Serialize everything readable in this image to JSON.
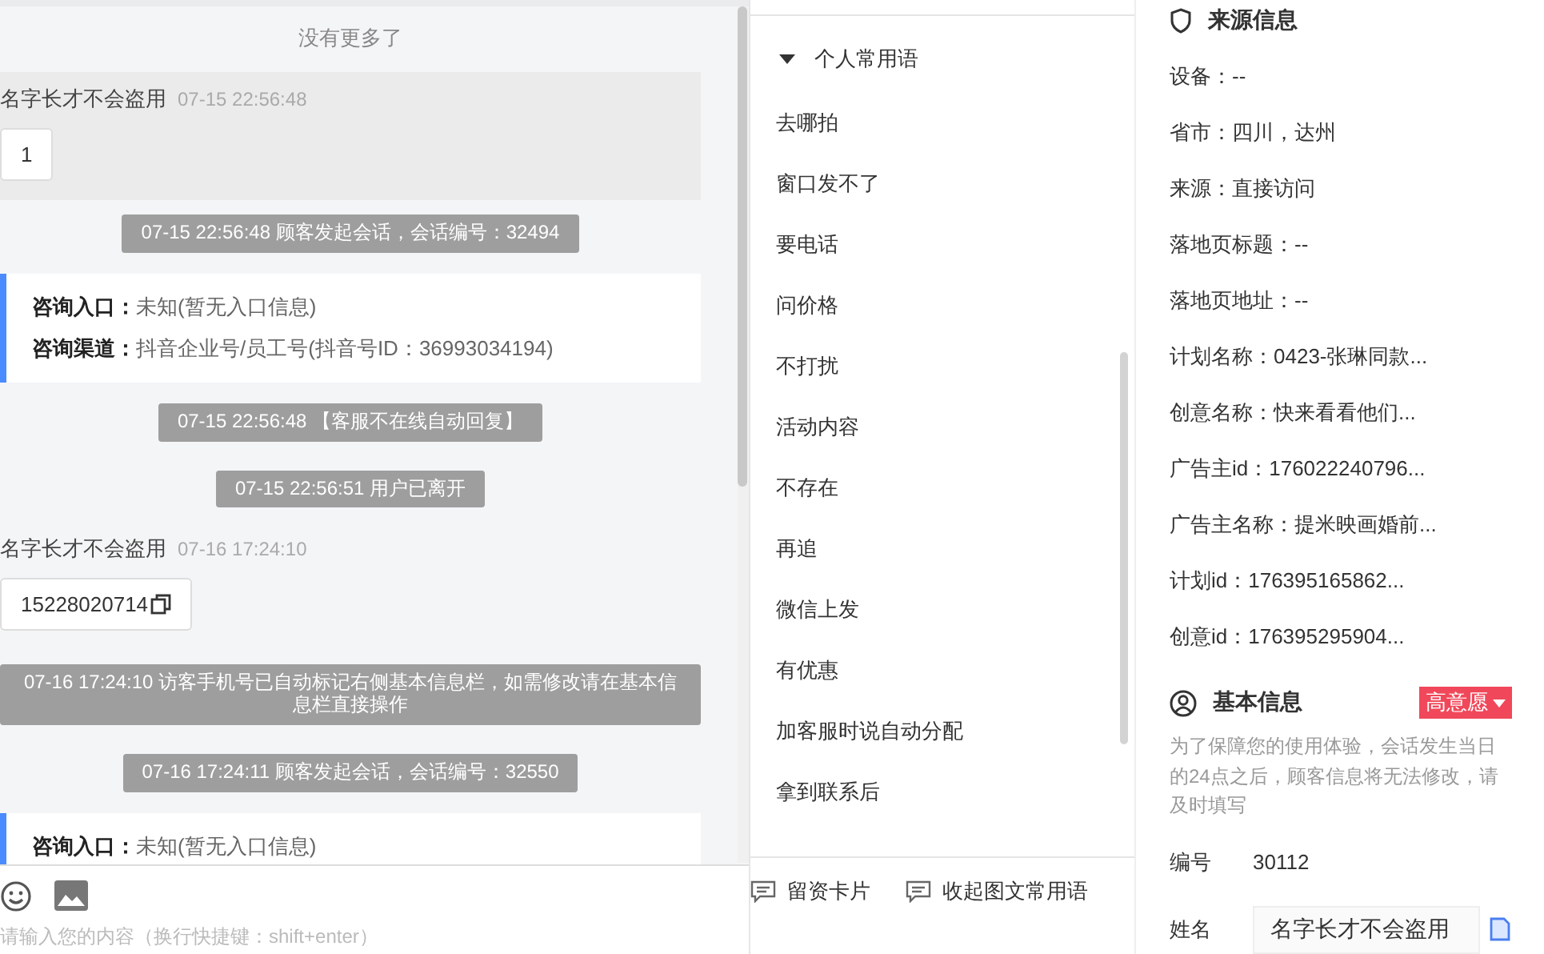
{
  "chat": {
    "top_note": "没有更多了",
    "messages": [
      {
        "kind": "visitor",
        "name": "名字长才不会盗用",
        "time": "07-15 22:56:48",
        "text": "1",
        "highlighted": true,
        "copyable": false
      },
      {
        "kind": "system",
        "text": "07-15 22:56:48 顾客发起会话，会话编号：32494"
      },
      {
        "kind": "info",
        "rows": [
          {
            "label": "咨询入口：",
            "value": "未知(暂无入口信息)"
          },
          {
            "label": "咨询渠道：",
            "value": "抖音企业号/员工号(抖音号ID：36993034194)"
          }
        ]
      },
      {
        "kind": "system",
        "text": "07-15 22:56:48 【客服不在线自动回复】"
      },
      {
        "kind": "system",
        "text": "07-15 22:56:51 用户已离开"
      },
      {
        "kind": "visitor",
        "name": "名字长才不会盗用",
        "time": "07-16 17:24:10",
        "text": "15228020714",
        "highlighted": false,
        "copyable": true
      },
      {
        "kind": "system",
        "text": "07-16 17:24:10 访客手机号已自动标记右侧基本信息栏，如需修改请在基本信息栏直接操作"
      },
      {
        "kind": "system",
        "text": "07-16 17:24:11 顾客发起会话，会话编号：32550"
      },
      {
        "kind": "info",
        "rows": [
          {
            "label": "咨询入口：",
            "value": "未知(暂无入口信息)"
          }
        ]
      }
    ],
    "input_placeholder": "请输入您的内容（换行快捷键：shift+enter）"
  },
  "phrases": {
    "header": "个人常用语",
    "expanded": true,
    "items": [
      "去哪拍",
      "窗口发不了",
      "要电话",
      "问价格",
      "不打扰",
      "活动内容",
      "不存在",
      "再追",
      "微信上发",
      "有优惠",
      "加客服时说自动分配",
      "拿到联系后"
    ],
    "footer_buttons": [
      "留资卡片",
      "收起图文常用语"
    ]
  },
  "source_info": {
    "title": "来源信息",
    "lines": [
      "设备：--",
      "省市：四川，达州",
      "来源：直接访问",
      "落地页标题：--",
      "落地页地址：--",
      "计划名称：0423-张琳同款...",
      "创意名称：快来看看他们...",
      "广告主id：176022240796...",
      "广告主名称：提米映画婚前...",
      "计划id：176395165862...",
      "创意id：176395295904..."
    ]
  },
  "basic_info": {
    "title": "基本信息",
    "tag": "高意愿",
    "note": "为了保障您的使用体验，会话发生当日的24点之后，顾客信息将无法修改，请及时填写",
    "fields": [
      {
        "kind": "text",
        "label": "编号",
        "value": "30112"
      },
      {
        "kind": "input",
        "label": "姓名",
        "value": "名字长才不会盗用"
      }
    ]
  }
}
